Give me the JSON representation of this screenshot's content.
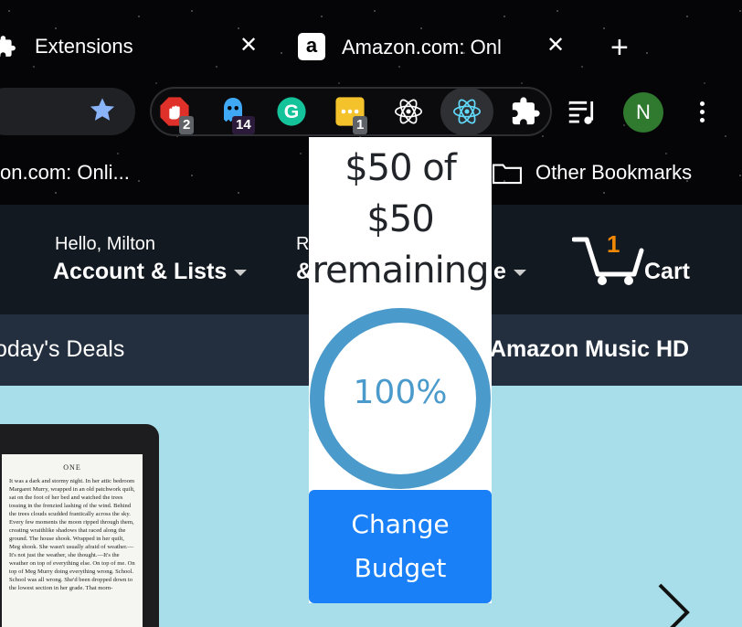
{
  "browser": {
    "tabs": [
      {
        "title": "Extensions",
        "close": "✕"
      },
      {
        "title": "Amazon.com: Onl",
        "close": "✕",
        "favicon": "a"
      }
    ],
    "new_tab": "+",
    "extensions": [
      {
        "icon": "adblock-stop-icon",
        "badge": "2"
      },
      {
        "icon": "ghostery-icon",
        "badge": "14"
      },
      {
        "icon": "grammarly-icon",
        "label": "G"
      },
      {
        "icon": "notes-icon",
        "badge": "1"
      },
      {
        "icon": "react-devtools-icon"
      },
      {
        "icon": "react-active-icon"
      },
      {
        "icon": "puzzle-icon"
      },
      {
        "icon": "media-queue-icon"
      }
    ],
    "profile_initial": "N",
    "bookmarks": {
      "amazon": "on.com: Onli...",
      "other": "Other Bookmarks"
    }
  },
  "amazon": {
    "hello": "Hello, Milton",
    "account": "Account & Lists",
    "returns_prefix": "R",
    "orders_prefix": "&",
    "orders_tail": "e",
    "cart_count": "1",
    "cart_label": "Cart",
    "deals": "oday's Deals",
    "music": "Amazon Music HD",
    "kindle": {
      "chapter": "ONE",
      "text": "It was a dark and stormy night. In her attic bedroom Margaret Murry, wrapped in an old patchwork quilt, sat on the foot of her bed and watched the trees tossing in the frenzied lashing of the wind. Behind the trees clouds scudded frantically across the sky. Every few moments the moon ripped through them, creating wraithlike shadows that raced along the ground. The house shook. Wrapped in her quilt, Meg shook. She wasn't usually afraid of weather.—It's not just the weather, she thought.—It's the weather on top of everything else. On top of me. On top of Meg Murry doing everything wrong. School. School was all wrong. She'd been dropped down to the lowest section in her grade. That morn-"
    }
  },
  "popup": {
    "budget_line1": "$50 of",
    "budget_line2": "$50",
    "budget_line3": "remaining",
    "percent_label": "100%",
    "percent_value": 100,
    "button_line1": "Change",
    "button_line2": "Budget",
    "colors": {
      "ring": "#4a9acb",
      "button": "#1a80f8"
    }
  }
}
